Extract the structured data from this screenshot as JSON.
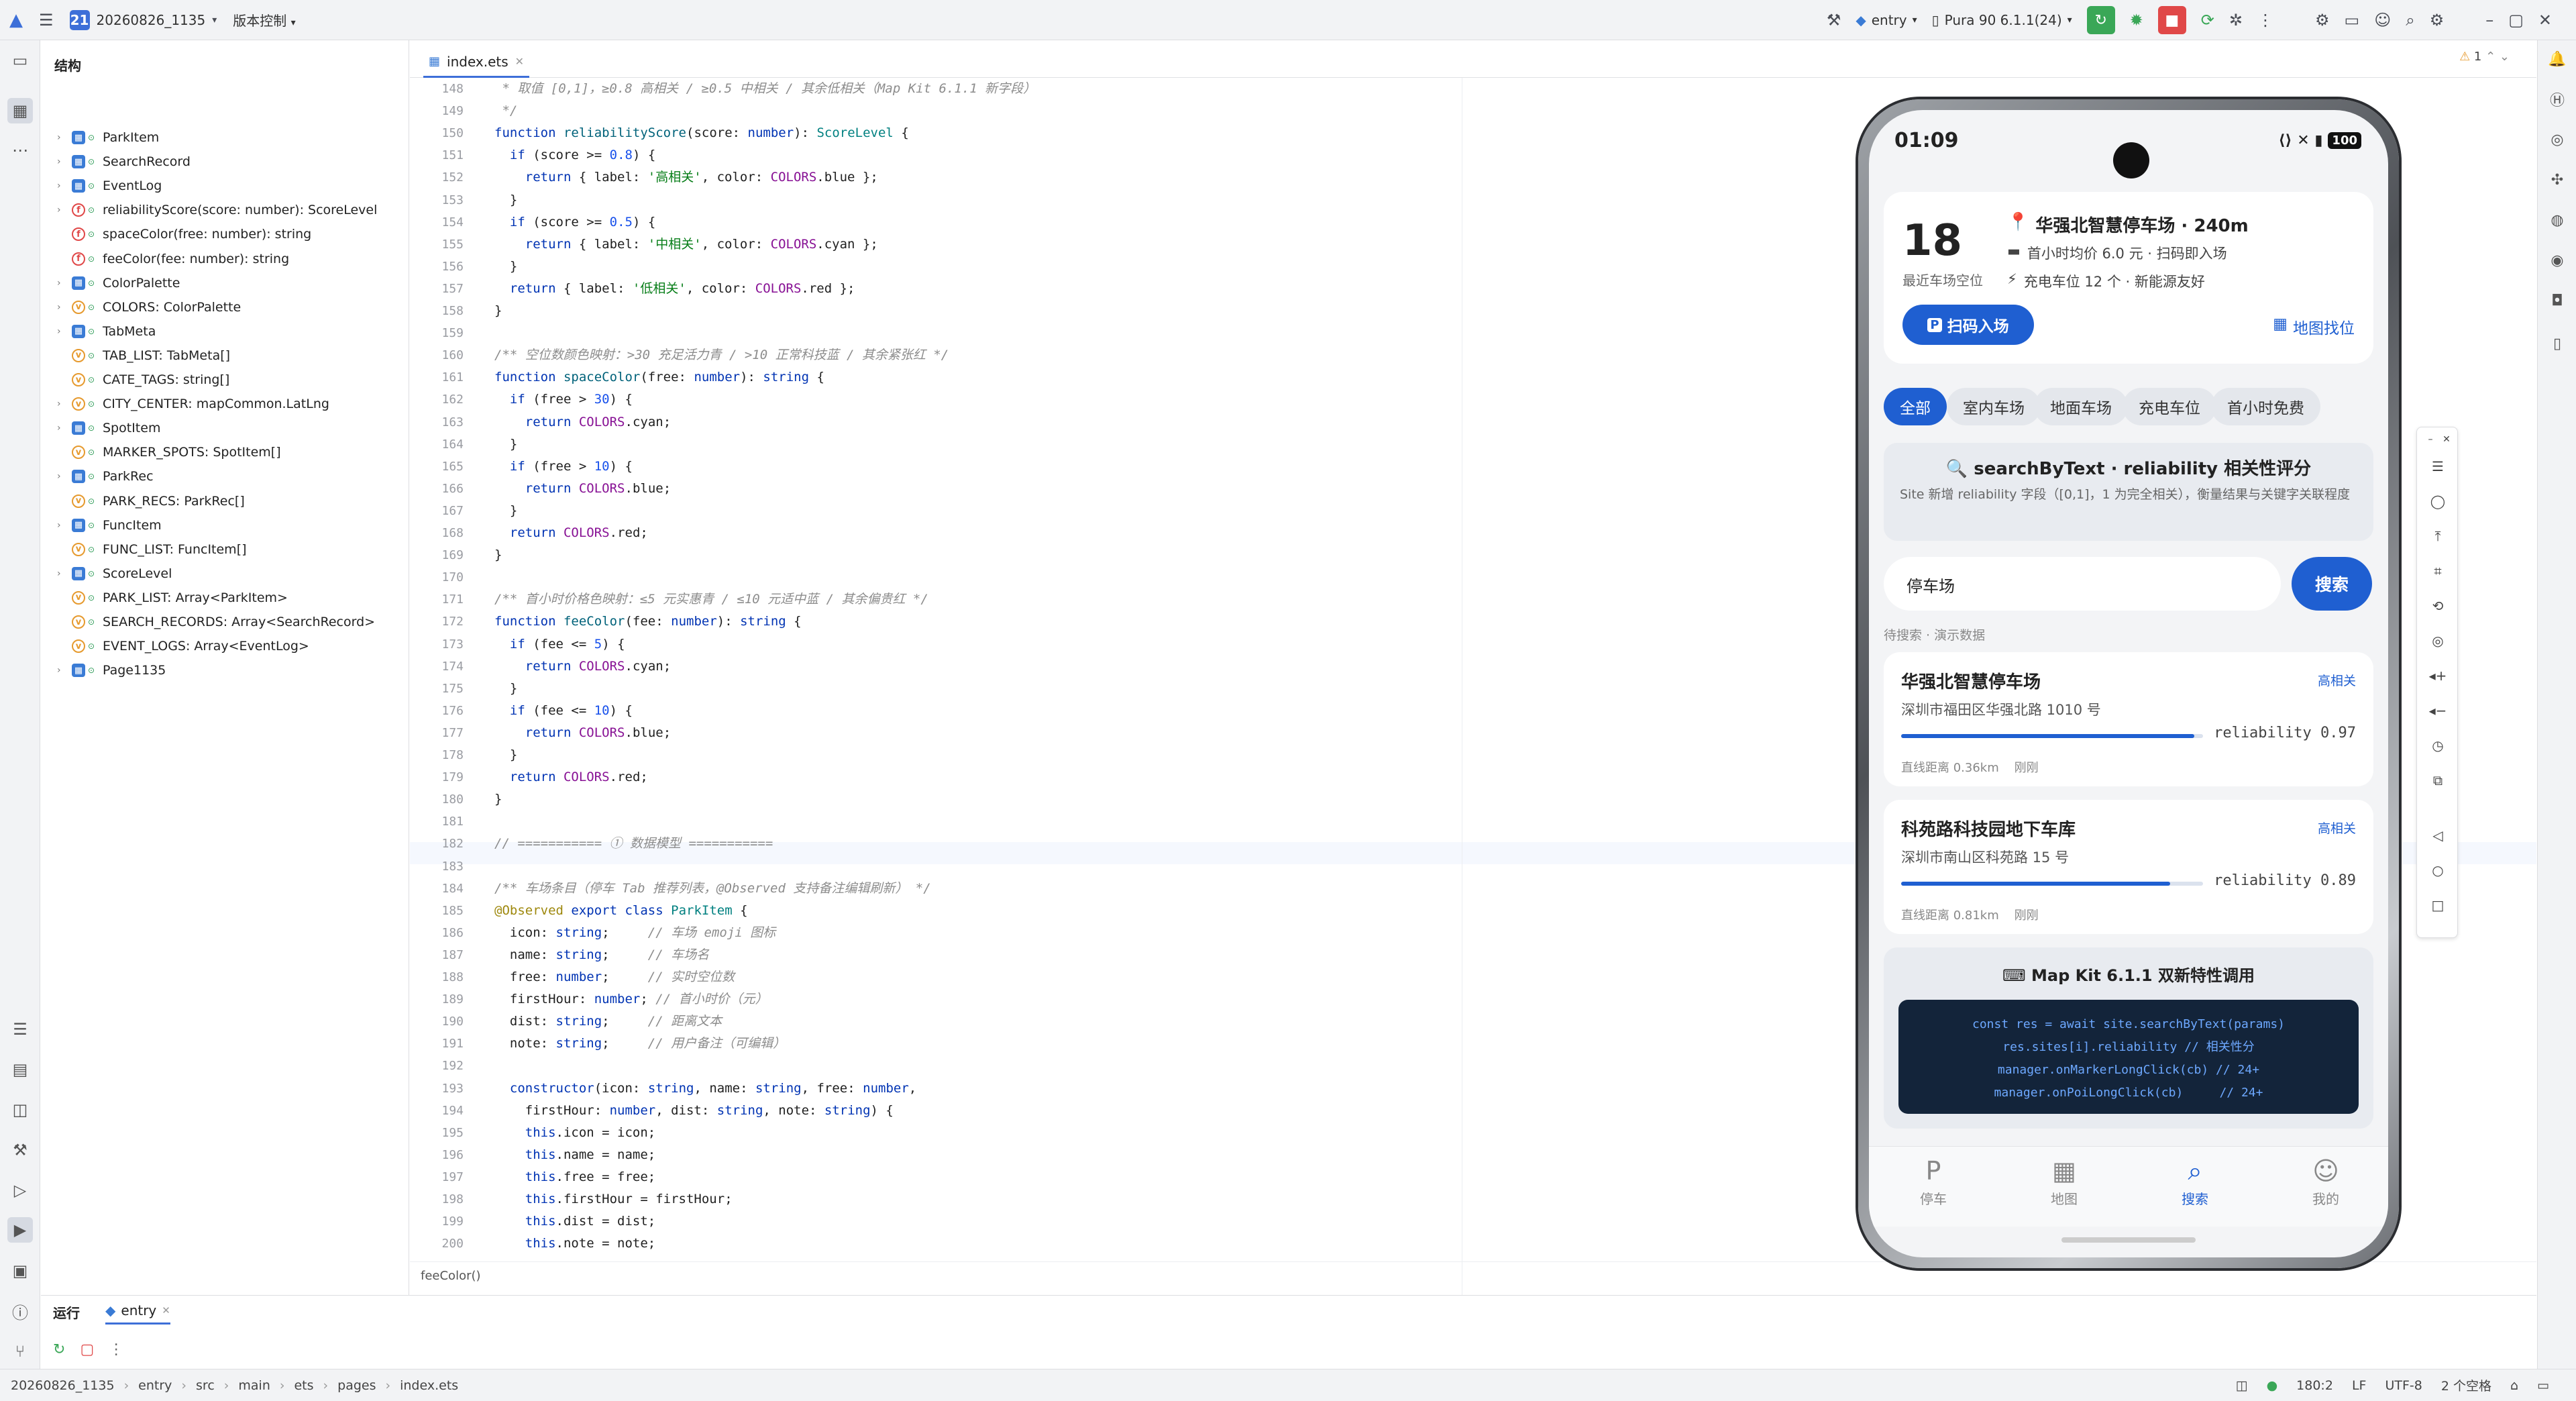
{
  "topbar": {
    "project_badge": "21",
    "project_name": "20260826_1135",
    "vcs": "版本控制",
    "module": "entry",
    "device": "Pura 90 6.1.1(24)"
  },
  "structure": {
    "title": "结构",
    "items": [
      {
        "label": "ParkItem",
        "kind": "c",
        "expandable": true
      },
      {
        "label": "SearchRecord",
        "kind": "c",
        "expandable": true
      },
      {
        "label": "EventLog",
        "kind": "c",
        "expandable": true
      },
      {
        "label": "reliabilityScore(score: number): ScoreLevel",
        "kind": "f",
        "expandable": true
      },
      {
        "label": "spaceColor(free: number): string",
        "kind": "f",
        "expandable": false
      },
      {
        "label": "feeColor(fee: number): string",
        "kind": "f",
        "expandable": false
      },
      {
        "label": "ColorPalette",
        "kind": "c",
        "expandable": true
      },
      {
        "label": "COLORS: ColorPalette",
        "kind": "v",
        "expandable": true
      },
      {
        "label": "TabMeta",
        "kind": "c",
        "expandable": true
      },
      {
        "label": "TAB_LIST: TabMeta[]",
        "kind": "v",
        "expandable": false
      },
      {
        "label": "CATE_TAGS: string[]",
        "kind": "v",
        "expandable": false
      },
      {
        "label": "CITY_CENTER: mapCommon.LatLng",
        "kind": "v",
        "expandable": true
      },
      {
        "label": "SpotItem",
        "kind": "c",
        "expandable": true
      },
      {
        "label": "MARKER_SPOTS: SpotItem[]",
        "kind": "v",
        "expandable": false
      },
      {
        "label": "ParkRec",
        "kind": "c",
        "expandable": true
      },
      {
        "label": "PARK_RECS: ParkRec[]",
        "kind": "v",
        "expandable": false
      },
      {
        "label": "FuncItem",
        "kind": "c",
        "expandable": true
      },
      {
        "label": "FUNC_LIST: FuncItem[]",
        "kind": "v",
        "expandable": false
      },
      {
        "label": "ScoreLevel",
        "kind": "c",
        "expandable": true
      },
      {
        "label": "PARK_LIST: Array<ParkItem>",
        "kind": "v",
        "expandable": false
      },
      {
        "label": "SEARCH_RECORDS: Array<SearchRecord>",
        "kind": "v",
        "expandable": false
      },
      {
        "label": "EVENT_LOGS: Array<EventLog>",
        "kind": "v",
        "expandable": false
      },
      {
        "label": "Page1135",
        "kind": "c",
        "expandable": true
      }
    ]
  },
  "editor": {
    "tab": "index.ets",
    "breadcrumb": "feeColor()",
    "warnings": "1"
  },
  "bottom": {
    "run_label": "运行",
    "run_tab": "entry"
  },
  "status": {
    "path": [
      "20260826_1135",
      "entry",
      "src",
      "main",
      "ets",
      "pages",
      "index.ets"
    ],
    "position": "180:2",
    "line_sep": "LF",
    "encoding": "UTF-8",
    "indent": "2 个空格"
  },
  "phone": {
    "time": "01:09",
    "battery": "100",
    "hero": {
      "count": "18",
      "count_label": "最近车场空位",
      "name": "华强北智慧停车场 · 240m",
      "line1": "首小时均价 6.0 元 · 扫码即入场",
      "line2": "充电车位 12 个 · 新能源友好",
      "scan_btn": "扫码入场",
      "map_btn": "地图找位"
    },
    "chips": [
      "全部",
      "室内车场",
      "地面车场",
      "充电车位",
      "首小时免费"
    ],
    "search_card": {
      "title": "searchByText · reliability 相关性评分",
      "desc": "Site 新增 reliability 字段（[0,1]，1 为完全相关），衡量结果与关键字关联程度"
    },
    "search": {
      "value": "停车场",
      "button": "搜索",
      "hint": "待搜索 · 演示数据"
    },
    "results": [
      {
        "name": "华强北智慧停车场",
        "tag": "高相关",
        "addr": "深圳市福田区华强北路 1010 号",
        "score": "reliability 0.97",
        "value": 0.97,
        "meta": "直线距离 0.36km    刚刚"
      },
      {
        "name": "科苑路科技园地下车库",
        "tag": "高相关",
        "addr": "深圳市南山区科苑路 15 号",
        "score": "reliability 0.89",
        "value": 0.89,
        "meta": "直线距离 0.81km    刚刚"
      }
    ],
    "feature": {
      "title": "Map Kit 6.1.1 双新特性调用",
      "code": [
        "const res = await site.searchByText(params)",
        "res.sites[i].reliability // 相关性分",
        "manager.onMarkerLongClick(cb) // 24+",
        "manager.onPoiLongClick(cb)     // 24+"
      ]
    },
    "tabs": [
      {
        "label": "停车",
        "icon": "P"
      },
      {
        "label": "地图",
        "icon": "▦"
      },
      {
        "label": "搜索",
        "icon": "⌕"
      },
      {
        "label": "我的",
        "icon": "☺"
      }
    ]
  }
}
